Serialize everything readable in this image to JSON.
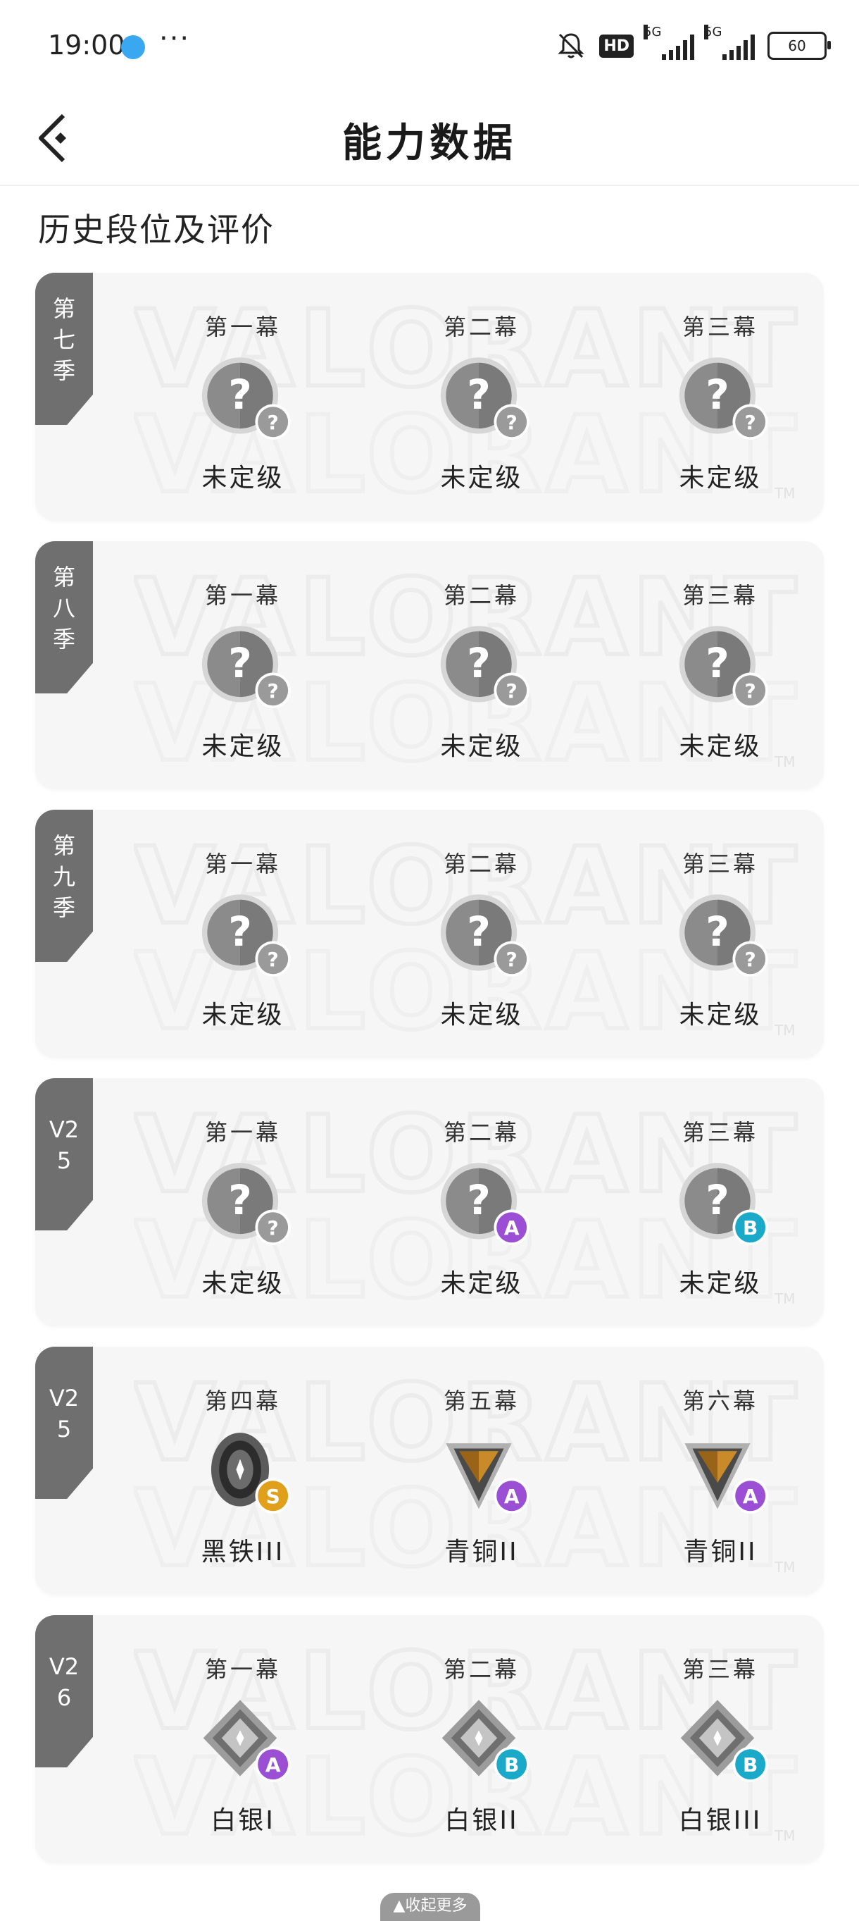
{
  "status_bar": {
    "time": "19:00",
    "more": "···",
    "hd": "HD",
    "net1": "5G",
    "net2": "5G",
    "battery": "60"
  },
  "header": {
    "title": "能力数据"
  },
  "section_title": "历史段位及评价",
  "watermark": "VALORANT",
  "watermark_tm": "TM",
  "seasons": [
    {
      "tag": "第七季",
      "acts": [
        {
          "label": "第一幕",
          "rank": "未定级",
          "emblem": "unranked",
          "grade": "?",
          "grade_color": "#9a9a9a"
        },
        {
          "label": "第二幕",
          "rank": "未定级",
          "emblem": "unranked",
          "grade": "?",
          "grade_color": "#9a9a9a"
        },
        {
          "label": "第三幕",
          "rank": "未定级",
          "emblem": "unranked",
          "grade": "?",
          "grade_color": "#9a9a9a"
        }
      ]
    },
    {
      "tag": "第八季",
      "acts": [
        {
          "label": "第一幕",
          "rank": "未定级",
          "emblem": "unranked",
          "grade": "?",
          "grade_color": "#9a9a9a"
        },
        {
          "label": "第二幕",
          "rank": "未定级",
          "emblem": "unranked",
          "grade": "?",
          "grade_color": "#9a9a9a"
        },
        {
          "label": "第三幕",
          "rank": "未定级",
          "emblem": "unranked",
          "grade": "?",
          "grade_color": "#9a9a9a"
        }
      ]
    },
    {
      "tag": "第九季",
      "acts": [
        {
          "label": "第一幕",
          "rank": "未定级",
          "emblem": "unranked",
          "grade": "?",
          "grade_color": "#9a9a9a"
        },
        {
          "label": "第二幕",
          "rank": "未定级",
          "emblem": "unranked",
          "grade": "?",
          "grade_color": "#9a9a9a"
        },
        {
          "label": "第三幕",
          "rank": "未定级",
          "emblem": "unranked",
          "grade": "?",
          "grade_color": "#9a9a9a"
        }
      ]
    },
    {
      "tag": "V25",
      "acts": [
        {
          "label": "第一幕",
          "rank": "未定级",
          "emblem": "unranked",
          "grade": "?",
          "grade_color": "#9a9a9a"
        },
        {
          "label": "第二幕",
          "rank": "未定级",
          "emblem": "unranked",
          "grade": "A",
          "grade_color": "#9b4fd4"
        },
        {
          "label": "第三幕",
          "rank": "未定级",
          "emblem": "unranked",
          "grade": "B",
          "grade_color": "#1aa9c9"
        }
      ]
    },
    {
      "tag": "V25",
      "acts": [
        {
          "label": "第四幕",
          "rank": "黑铁III",
          "emblem": "iron",
          "grade": "S",
          "grade_color": "#e0a01c"
        },
        {
          "label": "第五幕",
          "rank": "青铜II",
          "emblem": "bronze",
          "grade": "A",
          "grade_color": "#9b4fd4"
        },
        {
          "label": "第六幕",
          "rank": "青铜II",
          "emblem": "bronze",
          "grade": "A",
          "grade_color": "#9b4fd4"
        }
      ]
    },
    {
      "tag": "V26",
      "acts": [
        {
          "label": "第一幕",
          "rank": "白银I",
          "emblem": "silver1",
          "grade": "A",
          "grade_color": "#9b4fd4"
        },
        {
          "label": "第二幕",
          "rank": "白银II",
          "emblem": "silver2",
          "grade": "B",
          "grade_color": "#1aa9c9"
        },
        {
          "label": "第三幕",
          "rank": "白银III",
          "emblem": "silver3",
          "grade": "B",
          "grade_color": "#1aa9c9"
        }
      ]
    }
  ],
  "collapse_label": "▲收起更多"
}
